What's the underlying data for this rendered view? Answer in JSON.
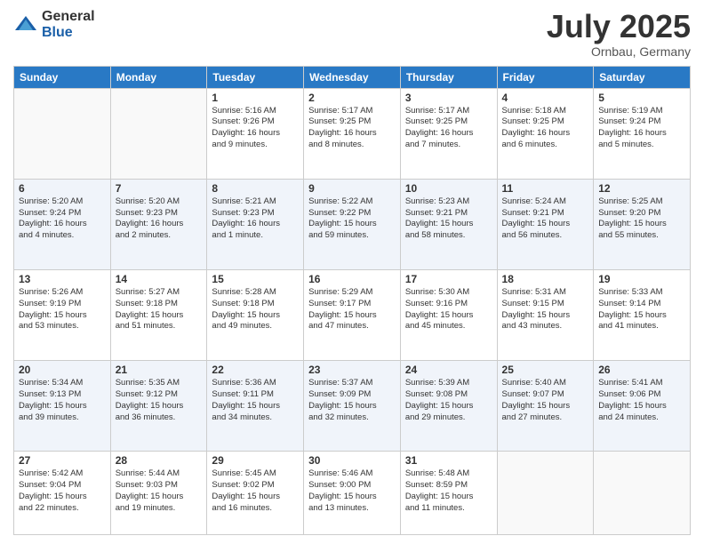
{
  "logo": {
    "general": "General",
    "blue": "Blue"
  },
  "title": {
    "month_year": "July 2025",
    "location": "Ornbau, Germany"
  },
  "headers": [
    "Sunday",
    "Monday",
    "Tuesday",
    "Wednesday",
    "Thursday",
    "Friday",
    "Saturday"
  ],
  "weeks": [
    [
      {
        "day": "",
        "info": ""
      },
      {
        "day": "",
        "info": ""
      },
      {
        "day": "1",
        "info": "Sunrise: 5:16 AM\nSunset: 9:26 PM\nDaylight: 16 hours\nand 9 minutes."
      },
      {
        "day": "2",
        "info": "Sunrise: 5:17 AM\nSunset: 9:25 PM\nDaylight: 16 hours\nand 8 minutes."
      },
      {
        "day": "3",
        "info": "Sunrise: 5:17 AM\nSunset: 9:25 PM\nDaylight: 16 hours\nand 7 minutes."
      },
      {
        "day": "4",
        "info": "Sunrise: 5:18 AM\nSunset: 9:25 PM\nDaylight: 16 hours\nand 6 minutes."
      },
      {
        "day": "5",
        "info": "Sunrise: 5:19 AM\nSunset: 9:24 PM\nDaylight: 16 hours\nand 5 minutes."
      }
    ],
    [
      {
        "day": "6",
        "info": "Sunrise: 5:20 AM\nSunset: 9:24 PM\nDaylight: 16 hours\nand 4 minutes."
      },
      {
        "day": "7",
        "info": "Sunrise: 5:20 AM\nSunset: 9:23 PM\nDaylight: 16 hours\nand 2 minutes."
      },
      {
        "day": "8",
        "info": "Sunrise: 5:21 AM\nSunset: 9:23 PM\nDaylight: 16 hours\nand 1 minute."
      },
      {
        "day": "9",
        "info": "Sunrise: 5:22 AM\nSunset: 9:22 PM\nDaylight: 15 hours\nand 59 minutes."
      },
      {
        "day": "10",
        "info": "Sunrise: 5:23 AM\nSunset: 9:21 PM\nDaylight: 15 hours\nand 58 minutes."
      },
      {
        "day": "11",
        "info": "Sunrise: 5:24 AM\nSunset: 9:21 PM\nDaylight: 15 hours\nand 56 minutes."
      },
      {
        "day": "12",
        "info": "Sunrise: 5:25 AM\nSunset: 9:20 PM\nDaylight: 15 hours\nand 55 minutes."
      }
    ],
    [
      {
        "day": "13",
        "info": "Sunrise: 5:26 AM\nSunset: 9:19 PM\nDaylight: 15 hours\nand 53 minutes."
      },
      {
        "day": "14",
        "info": "Sunrise: 5:27 AM\nSunset: 9:18 PM\nDaylight: 15 hours\nand 51 minutes."
      },
      {
        "day": "15",
        "info": "Sunrise: 5:28 AM\nSunset: 9:18 PM\nDaylight: 15 hours\nand 49 minutes."
      },
      {
        "day": "16",
        "info": "Sunrise: 5:29 AM\nSunset: 9:17 PM\nDaylight: 15 hours\nand 47 minutes."
      },
      {
        "day": "17",
        "info": "Sunrise: 5:30 AM\nSunset: 9:16 PM\nDaylight: 15 hours\nand 45 minutes."
      },
      {
        "day": "18",
        "info": "Sunrise: 5:31 AM\nSunset: 9:15 PM\nDaylight: 15 hours\nand 43 minutes."
      },
      {
        "day": "19",
        "info": "Sunrise: 5:33 AM\nSunset: 9:14 PM\nDaylight: 15 hours\nand 41 minutes."
      }
    ],
    [
      {
        "day": "20",
        "info": "Sunrise: 5:34 AM\nSunset: 9:13 PM\nDaylight: 15 hours\nand 39 minutes."
      },
      {
        "day": "21",
        "info": "Sunrise: 5:35 AM\nSunset: 9:12 PM\nDaylight: 15 hours\nand 36 minutes."
      },
      {
        "day": "22",
        "info": "Sunrise: 5:36 AM\nSunset: 9:11 PM\nDaylight: 15 hours\nand 34 minutes."
      },
      {
        "day": "23",
        "info": "Sunrise: 5:37 AM\nSunset: 9:09 PM\nDaylight: 15 hours\nand 32 minutes."
      },
      {
        "day": "24",
        "info": "Sunrise: 5:39 AM\nSunset: 9:08 PM\nDaylight: 15 hours\nand 29 minutes."
      },
      {
        "day": "25",
        "info": "Sunrise: 5:40 AM\nSunset: 9:07 PM\nDaylight: 15 hours\nand 27 minutes."
      },
      {
        "day": "26",
        "info": "Sunrise: 5:41 AM\nSunset: 9:06 PM\nDaylight: 15 hours\nand 24 minutes."
      }
    ],
    [
      {
        "day": "27",
        "info": "Sunrise: 5:42 AM\nSunset: 9:04 PM\nDaylight: 15 hours\nand 22 minutes."
      },
      {
        "day": "28",
        "info": "Sunrise: 5:44 AM\nSunset: 9:03 PM\nDaylight: 15 hours\nand 19 minutes."
      },
      {
        "day": "29",
        "info": "Sunrise: 5:45 AM\nSunset: 9:02 PM\nDaylight: 15 hours\nand 16 minutes."
      },
      {
        "day": "30",
        "info": "Sunrise: 5:46 AM\nSunset: 9:00 PM\nDaylight: 15 hours\nand 13 minutes."
      },
      {
        "day": "31",
        "info": "Sunrise: 5:48 AM\nSunset: 8:59 PM\nDaylight: 15 hours\nand 11 minutes."
      },
      {
        "day": "",
        "info": ""
      },
      {
        "day": "",
        "info": ""
      }
    ]
  ]
}
